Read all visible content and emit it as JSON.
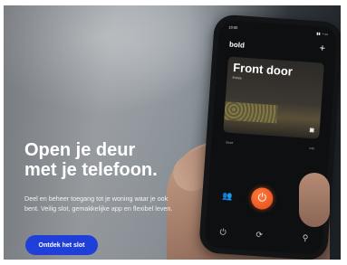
{
  "hero": {
    "headline_line1": "Open je deur",
    "headline_line2": "met je telefoon.",
    "body": "Deel en beheer toegang tot je woning waar je ook bent. Veilig slot, gemakkelijke app en flexibel leven.",
    "cta_label": "Ontdek het slot",
    "cta_color": "#1f3fd8"
  },
  "phone_app": {
    "status_time": "10:00",
    "status_icons": "▮▮ ◔ ▭",
    "brand": "bold",
    "add_icon": "plus-icon",
    "add_glyph": "+",
    "door_title": "Front door",
    "door_subtitle": "Entrée",
    "camera_glyph": "◙",
    "tab_left": "Bezit",
    "tab_right": "Info",
    "unlock_color": "#e4491a",
    "icons": {
      "users": "👥",
      "unlock": "⏻",
      "grid": "⌗",
      "power": "⏻",
      "refresh": "⟳",
      "person": "⚲"
    }
  }
}
